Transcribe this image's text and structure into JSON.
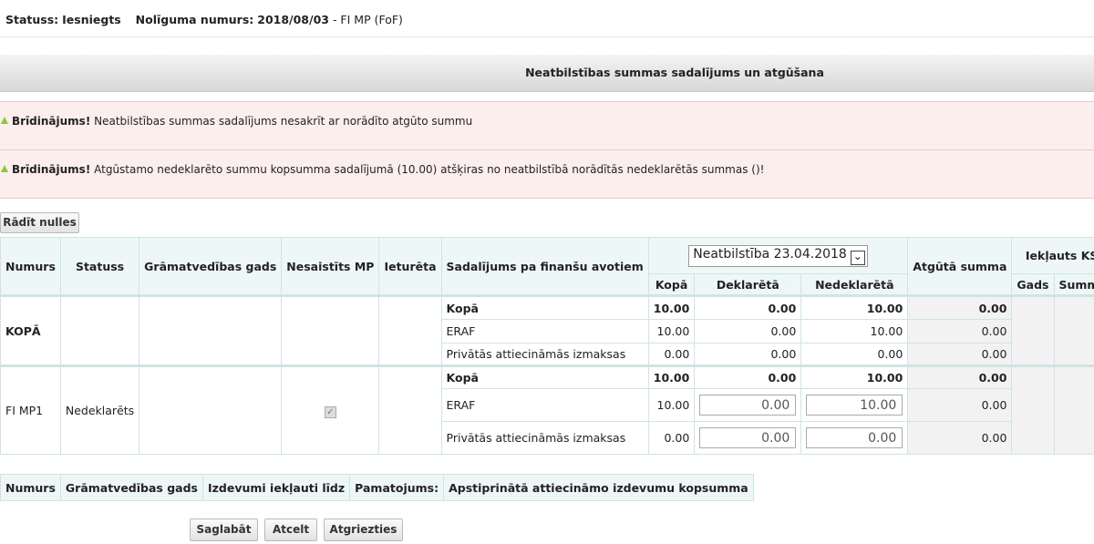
{
  "header": {
    "status_label": "Statuss:",
    "status_value": "Iesniegts",
    "contract_label": "Nolīguma numurs:",
    "contract_value": "2018/08/03",
    "contract_suffix": "- FI MP (FoF)"
  },
  "section_title": "Neatbilstības summas sadalījums un atgūšana",
  "warnings": [
    {
      "title": "Brīdinājums!",
      "text": "Neatbilstības summas sadalījums nesakrīt ar norādīto atgūto summu"
    },
    {
      "title": "Brīdinājums!",
      "text": "Atgūstamo nedeklarēto summu kopsumma sadalījumā (10.00) atšķiras no neatbilstībā norādītās nedeklarētās summas ()!"
    }
  ],
  "show_zeros_button": "Rādīt nulles",
  "table": {
    "headers": {
      "numurs": "Numurs",
      "statuss": "Statuss",
      "gads": "Grāmatvedības gads",
      "nesaistits": "Nesaistīts MP",
      "ieturets": "Ieturēta",
      "sadalijums": "Sadalījums pa finanšu avotiem",
      "neatbilstiba_select": "Neatbilstība 23.04.2018",
      "kopa": "Kopā",
      "deklareta": "Deklarētā",
      "nedeklareta": "Nedeklarētā",
      "atguta": "Atgūtā summa",
      "ieklauts_ks": "Iekļauts KS",
      "ks_gads": "Gads",
      "ks_summa": "Summa"
    },
    "group1": {
      "label": "KOPĀ",
      "rows": [
        {
          "source": "Kopā",
          "kopa": "10.00",
          "deklareta": "0.00",
          "nedeklareta": "10.00",
          "atguta": "0.00"
        },
        {
          "source": "ERAF",
          "kopa": "10.00",
          "deklareta": "0.00",
          "nedeklareta": "10.00",
          "atguta": "0.00"
        },
        {
          "source": "Privātās attiecināmās izmaksas",
          "kopa": "0.00",
          "deklareta": "0.00",
          "nedeklareta": "0.00",
          "atguta": "0.00"
        }
      ]
    },
    "group2": {
      "numurs": "FI MP1",
      "statuss": "Nedeklarēts",
      "rows": [
        {
          "source": "Kopā",
          "kopa": "10.00",
          "deklareta": "0.00",
          "nedeklareta": "10.00",
          "atguta": "0.00"
        },
        {
          "source": "ERAF",
          "kopa": "10.00",
          "deklareta": "0.00",
          "nedeklareta": "10.00",
          "atguta": "0.00"
        },
        {
          "source": "Privātās attiecināmās izmaksas",
          "kopa": "0.00",
          "deklareta": "0.00",
          "nedeklareta": "0.00",
          "atguta": "0.00"
        }
      ]
    }
  },
  "bottom_headers": [
    "Numurs",
    "Grāmatvedības gads",
    "Izdevumi iekļauti līdz",
    "Pamatojums:",
    "Apstiprinātā attiecināmo izdevumu kopsumma"
  ],
  "buttons": {
    "save": "Saglabāt",
    "cancel": "Atcelt",
    "back": "Atgriezties"
  }
}
